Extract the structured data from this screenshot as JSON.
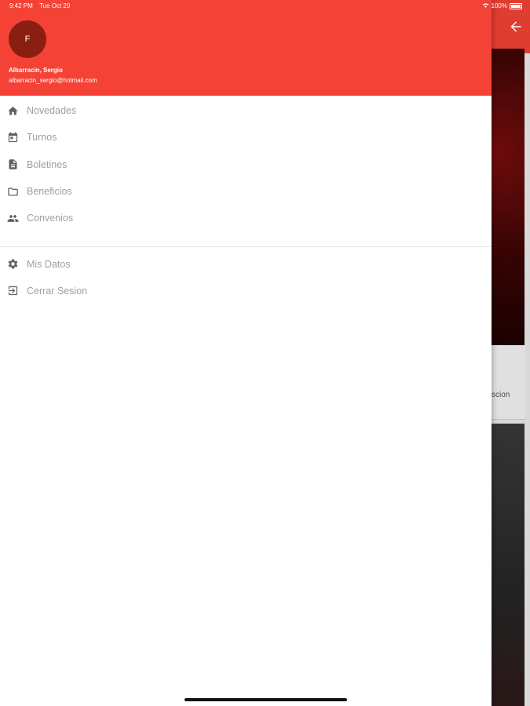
{
  "status_bar": {
    "time": "9:42 PM",
    "date": "Tue Oct 20",
    "battery": "100%"
  },
  "user": {
    "avatar_initial": "F",
    "name": "Albarracin, Sergio",
    "email": "albarracin_sergio@hotmail.com"
  },
  "menu": {
    "items": [
      {
        "label": "Novedades",
        "icon": "home-icon"
      },
      {
        "label": "Turnos",
        "icon": "calendar-icon"
      },
      {
        "label": "Boletines",
        "icon": "document-icon"
      },
      {
        "label": "Beneficios",
        "icon": "folder-icon"
      },
      {
        "label": "Convenios",
        "icon": "people-icon"
      }
    ],
    "secondary": [
      {
        "label": "Mis Datos",
        "icon": "settings-icon"
      },
      {
        "label": "Cerrar Sesion",
        "icon": "logout-icon"
      }
    ]
  },
  "background": {
    "card_text": "scion"
  },
  "colors": {
    "primary": "#f44336",
    "avatar": "#8b1e12",
    "menu_text": "#9e9e9e",
    "menu_icon": "#616161"
  }
}
